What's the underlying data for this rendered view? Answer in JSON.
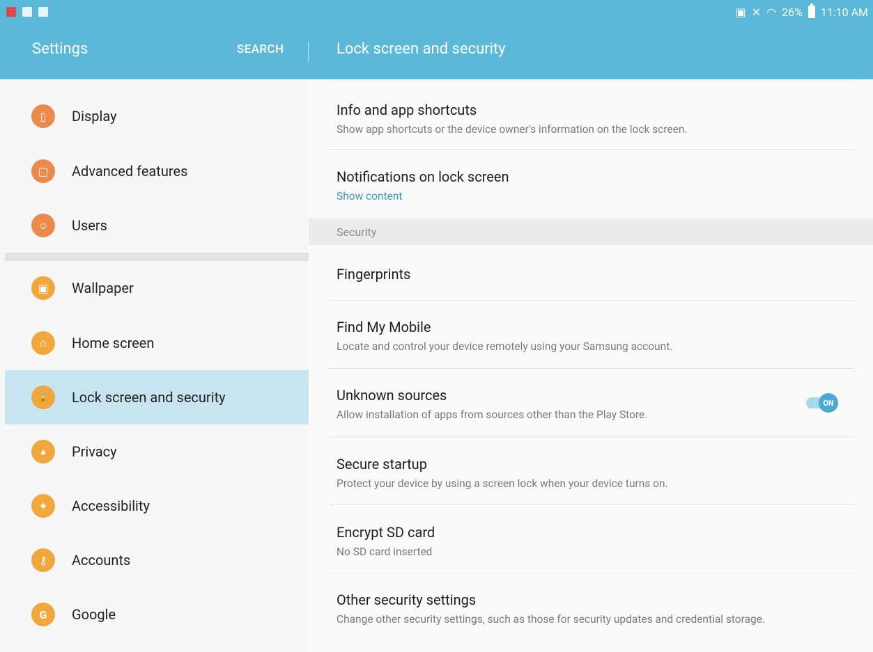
{
  "status_bar": {
    "battery": "26%",
    "time": "11:10 AM"
  },
  "header": {
    "left_title": "Settings",
    "search": "SEARCH",
    "right_title": "Lock screen and security"
  },
  "sidebar": {
    "items": [
      {
        "label": "Display",
        "icon": "display-icon",
        "color": "#ec8a4c",
        "glyph": "▯"
      },
      {
        "label": "Advanced features",
        "icon": "advanced-features-icon",
        "color": "#ec8a4c",
        "glyph": "▢"
      },
      {
        "label": "Users",
        "icon": "users-icon",
        "color": "#ec8a4c",
        "glyph": "☺"
      },
      {
        "label": "Wallpaper",
        "icon": "wallpaper-icon",
        "color": "#f0a73c",
        "glyph": "▣"
      },
      {
        "label": "Home screen",
        "icon": "home-icon",
        "color": "#f0a73c",
        "glyph": "⌂"
      },
      {
        "label": "Lock screen and security",
        "icon": "lock-icon",
        "color": "#f0a73c",
        "glyph": "🔒"
      },
      {
        "label": "Privacy",
        "icon": "privacy-icon",
        "color": "#f0a73c",
        "glyph": "▲"
      },
      {
        "label": "Accessibility",
        "icon": "accessibility-icon",
        "color": "#f0a73c",
        "glyph": "✦"
      },
      {
        "label": "Accounts",
        "icon": "key-icon",
        "color": "#f0a73c",
        "glyph": "⚷"
      },
      {
        "label": "Google",
        "icon": "google-icon",
        "color": "#f0a73c",
        "glyph": "G"
      }
    ],
    "selected_index": 5
  },
  "main": {
    "items": [
      {
        "title": "Info and app shortcuts",
        "subtitle": "Show app shortcuts or the device owner's information on the lock screen."
      },
      {
        "title": "Notifications on lock screen",
        "subtitle": "Show content"
      },
      {
        "title": "Fingerprints",
        "subtitle": ""
      },
      {
        "title": "Find My Mobile",
        "subtitle": "Locate and control your device remotely using your Samsung account."
      },
      {
        "title": "Unknown sources",
        "subtitle": "Allow installation of apps from sources other than the Play Store.",
        "toggle": "ON"
      },
      {
        "title": "Secure startup",
        "subtitle": "Protect your device by using a screen lock when your device turns on."
      },
      {
        "title": "Encrypt SD card",
        "subtitle": "No SD card inserted"
      },
      {
        "title": "Other security settings",
        "subtitle": "Change other security settings, such as those for security updates and credential storage."
      }
    ],
    "section_security": "Security"
  },
  "colors": {
    "header": "#5bb8d8",
    "selected": "#c6e5f1",
    "accent": "#3a97c5"
  }
}
